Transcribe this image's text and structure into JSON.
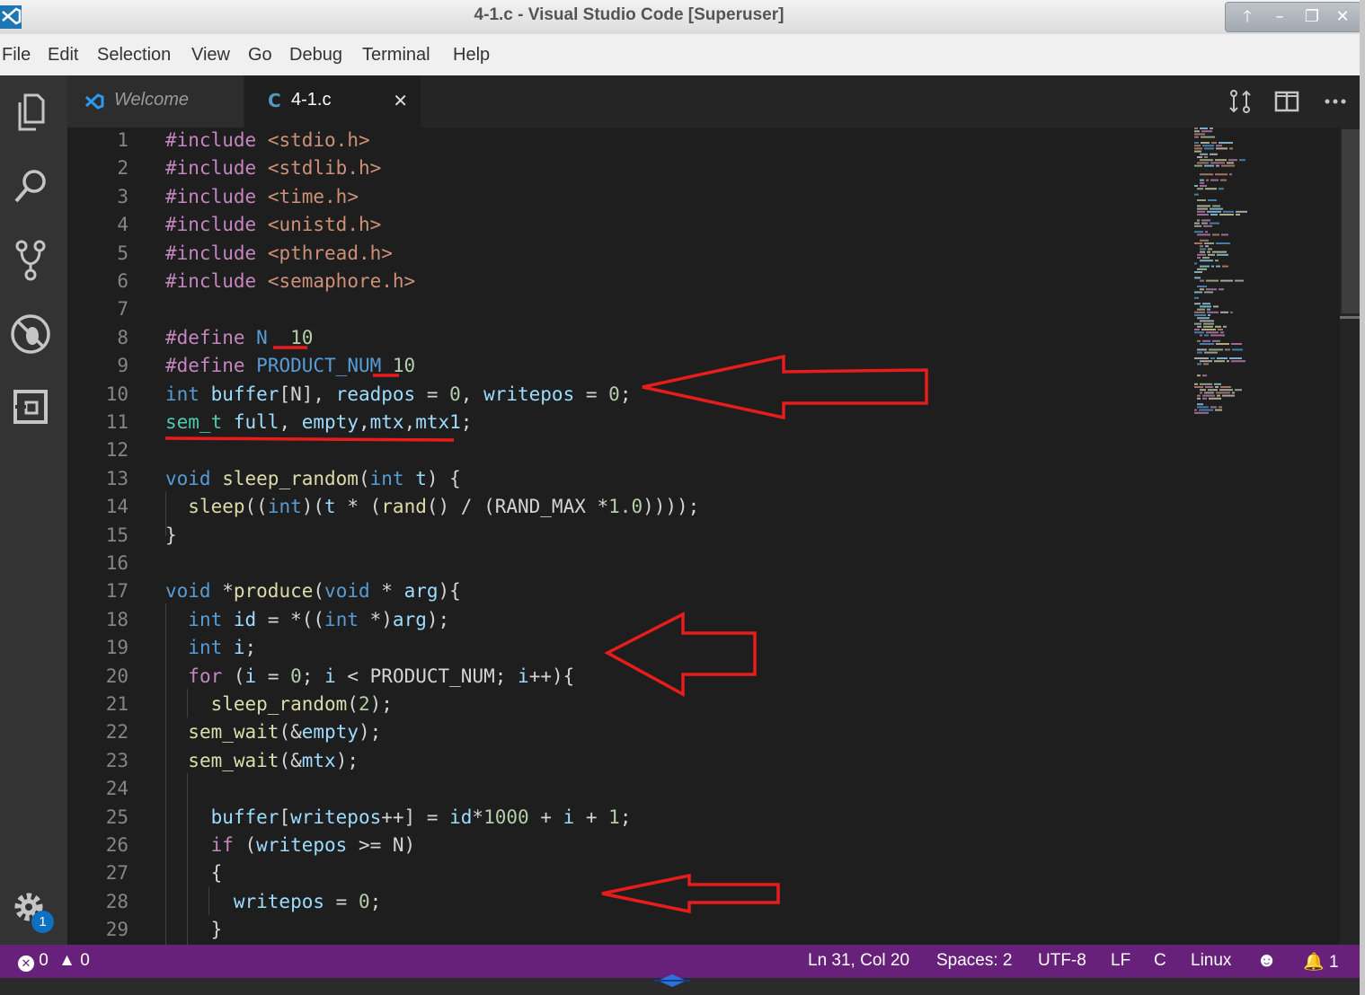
{
  "window": {
    "title": "4-1.c - Visual Studio Code [Superuser]"
  },
  "menu": [
    "File",
    "Edit",
    "Selection",
    "View",
    "Go",
    "Debug",
    "Terminal",
    "Help"
  ],
  "tabs": [
    {
      "label": "Welcome",
      "icon": "vscode-logo-icon"
    },
    {
      "label": "4-1.c",
      "icon": "C",
      "active": true
    }
  ],
  "activity_bar": [
    "explorer-icon",
    "search-icon",
    "source-control-icon",
    "debug-icon",
    "extensions-icon",
    "settings-gear-icon"
  ],
  "settings_badge": "1",
  "editor": {
    "lines": [
      {
        "n": "1",
        "html": "<span style='color:#c586c0'>#include</span> <span style='color:#ce9178'>&lt;stdio.h&gt;</span>"
      },
      {
        "n": "2",
        "html": "<span style='color:#c586c0'>#include</span> <span style='color:#ce9178'>&lt;stdlib.h&gt;</span>"
      },
      {
        "n": "3",
        "html": "<span style='color:#c586c0'>#include</span> <span style='color:#ce9178'>&lt;time.h&gt;</span>"
      },
      {
        "n": "4",
        "html": "<span style='color:#c586c0'>#include</span> <span style='color:#ce9178'>&lt;unistd.h&gt;</span>"
      },
      {
        "n": "5",
        "html": "<span style='color:#c586c0'>#include</span> <span style='color:#ce9178'>&lt;pthread.h&gt;</span>"
      },
      {
        "n": "6",
        "html": "<span style='color:#c586c0'>#include</span> <span style='color:#ce9178'>&lt;semaphore.h&gt;</span>"
      },
      {
        "n": "7",
        "html": ""
      },
      {
        "n": "8",
        "html": "<span style='color:#c586c0'>#define</span> <span style='color:#569cd6'>N</span>  <span style='color:#b5cea8'>10</span>"
      },
      {
        "n": "9",
        "html": "<span style='color:#c586c0'>#define</span> <span style='color:#569cd6'>PRODUCT_NUM</span> <span style='color:#b5cea8'>10</span>"
      },
      {
        "n": "10",
        "html": "<span style='color:#569cd6'>int</span> <span style='color:#9cdcfe'>buffer</span>[N], <span style='color:#9cdcfe'>readpos</span> = <span style='color:#b5cea8'>0</span>, <span style='color:#9cdcfe'>writepos</span> = <span style='color:#b5cea8'>0</span>;"
      },
      {
        "n": "11",
        "html": "<span style='color:#4ec9b0'>sem_t</span> <span style='color:#9cdcfe'>full</span>, <span style='color:#9cdcfe'>empty</span>,<span style='color:#9cdcfe'>mtx</span>,<span style='color:#9cdcfe'>mtx1</span>;"
      },
      {
        "n": "12",
        "html": ""
      },
      {
        "n": "13",
        "html": "<span style='color:#569cd6'>void</span> <span style='color:#dcdcaa'>sleep_random</span>(<span style='color:#569cd6'>int</span> <span style='color:#9cdcfe'>t</span>) {"
      },
      {
        "n": "14",
        "html": "  <span style='color:#dcdcaa'>sleep</span>((<span style='color:#569cd6'>int</span>)(<span style='color:#9cdcfe'>t</span> * (<span style='color:#dcdcaa'>rand</span>() / (RAND_MAX *<span style='color:#b5cea8'>1.0</span>))));"
      },
      {
        "n": "15",
        "html": "}"
      },
      {
        "n": "16",
        "html": ""
      },
      {
        "n": "17",
        "html": "<span style='color:#569cd6'>void</span> *<span style='color:#dcdcaa'>produce</span>(<span style='color:#569cd6'>void</span> * <span style='color:#9cdcfe'>arg</span>){"
      },
      {
        "n": "18",
        "html": "  <span style='color:#569cd6'>int</span> <span style='color:#9cdcfe'>id</span> = *((<span style='color:#569cd6'>int</span> *)<span style='color:#9cdcfe'>arg</span>);"
      },
      {
        "n": "19",
        "html": "  <span style='color:#569cd6'>int</span> <span style='color:#9cdcfe'>i</span>;"
      },
      {
        "n": "20",
        "html": "  <span style='color:#c586c0'>for</span> (<span style='color:#9cdcfe'>i</span> = <span style='color:#b5cea8'>0</span>; <span style='color:#9cdcfe'>i</span> &lt; PRODUCT_NUM; <span style='color:#9cdcfe'>i</span>++){"
      },
      {
        "n": "21",
        "html": "    <span style='color:#dcdcaa'>sleep_random</span>(<span style='color:#b5cea8'>2</span>);"
      },
      {
        "n": "22",
        "html": "  <span style='color:#dcdcaa'>sem_wait</span>(&amp;<span style='color:#9cdcfe'>empty</span>);"
      },
      {
        "n": "23",
        "html": "  <span style='color:#dcdcaa'>sem_wait</span>(&amp;<span style='color:#9cdcfe'>mtx</span>);"
      },
      {
        "n": "24",
        "html": ""
      },
      {
        "n": "25",
        "html": "    <span style='color:#9cdcfe'>buffer</span>[<span style='color:#9cdcfe'>writepos</span>++] = <span style='color:#9cdcfe'>id</span>*<span style='color:#b5cea8'>1000</span> + <span style='color:#9cdcfe'>i</span> + <span style='color:#b5cea8'>1</span>;"
      },
      {
        "n": "26",
        "html": "    <span style='color:#c586c0'>if</span> (<span style='color:#9cdcfe'>writepos</span> &gt;= N)"
      },
      {
        "n": "27",
        "html": "    {"
      },
      {
        "n": "28",
        "html": "      <span style='color:#9cdcfe'>writepos</span> = <span style='color:#b5cea8'>0</span>;"
      },
      {
        "n": "29",
        "html": "    }"
      }
    ]
  },
  "status": {
    "errors": "0",
    "warnings": "0",
    "position": "Ln 31, Col 20",
    "spaces": "Spaces: 2",
    "encoding": "UTF-8",
    "eol": "LF",
    "language": "C",
    "platform": "Linux",
    "notifications": "1"
  },
  "colors": {
    "accent": "#68217a",
    "annotation": "#e81c1c"
  }
}
